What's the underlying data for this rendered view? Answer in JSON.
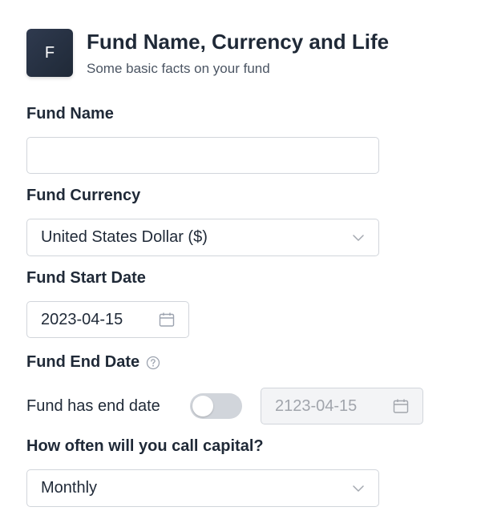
{
  "header": {
    "avatar_letter": "F",
    "title": "Fund Name, Currency and Life",
    "subtitle": "Some basic facts on your fund"
  },
  "fund_name": {
    "label": "Fund Name",
    "value": ""
  },
  "fund_currency": {
    "label": "Fund Currency",
    "value": "United States Dollar ($)"
  },
  "fund_start_date": {
    "label": "Fund Start Date",
    "value": "2023-04-15"
  },
  "fund_end_date": {
    "label": "Fund End Date",
    "toggle_label": "Fund has end date",
    "toggle_on": false,
    "value": "2123-04-15"
  },
  "capital_call": {
    "label": "How often will you call capital?",
    "value": "Monthly"
  },
  "icons": {
    "calendar": "calendar-icon",
    "chevron": "chevron-down-icon",
    "help": "question-circle-icon"
  }
}
